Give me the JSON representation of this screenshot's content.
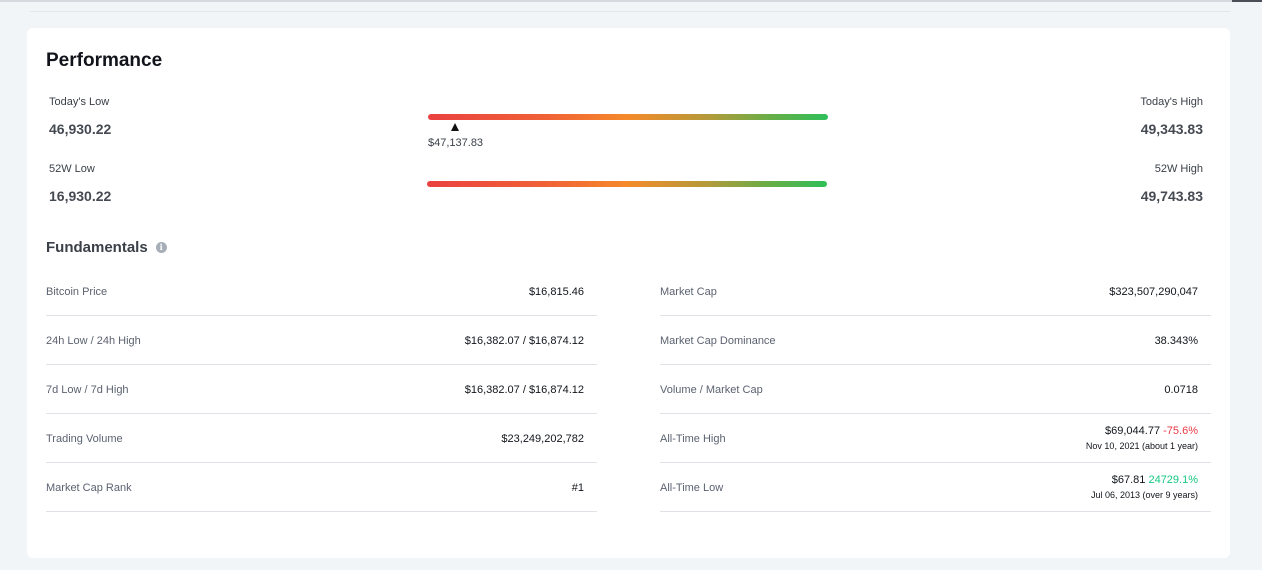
{
  "performance": {
    "title": "Performance",
    "today": {
      "low_label": "Today's Low",
      "low_value": "46,930.22",
      "high_label": "Today's High",
      "high_value": "49,343.83",
      "current_value": "$47,137.83"
    },
    "week52": {
      "low_label": "52W Low",
      "low_value": "16,930.22",
      "high_label": "52W High",
      "high_value": "49,743.83"
    },
    "colors": {
      "bar_start": "#ea4141",
      "bar_mid": "#f58a2a",
      "bar_end": "#2fbf5a"
    }
  },
  "fundamentals": {
    "title": "Fundamentals",
    "info_icon": "info-icon",
    "left": [
      {
        "label": "Bitcoin Price",
        "value": "$16,815.46"
      },
      {
        "label": "24h Low / 24h High",
        "value": "$16,382.07 / $16,874.12"
      },
      {
        "label": "7d Low / 7d High",
        "value": "$16,382.07 / $16,874.12"
      },
      {
        "label": "Trading Volume",
        "value": "$23,249,202,782"
      },
      {
        "label": "Market Cap Rank",
        "value": "#1"
      }
    ],
    "right": [
      {
        "label": "Market Cap",
        "value": "$323,507,290,047"
      },
      {
        "label": "Market Cap Dominance",
        "value": "38.343%"
      },
      {
        "label": "Volume / Market Cap",
        "value": "0.0718"
      },
      {
        "label": "All-Time High",
        "value": "$69,044.77",
        "change": "-75.6%",
        "sub": "Nov 10, 2021 (about 1 year)"
      },
      {
        "label": "All-Time Low",
        "value": "$67.81",
        "change": "24729.1%",
        "sub": "Jul 06, 2013 (over 9 years)"
      }
    ],
    "colors": {
      "negative": "#ea3943",
      "positive": "#16c784"
    }
  }
}
